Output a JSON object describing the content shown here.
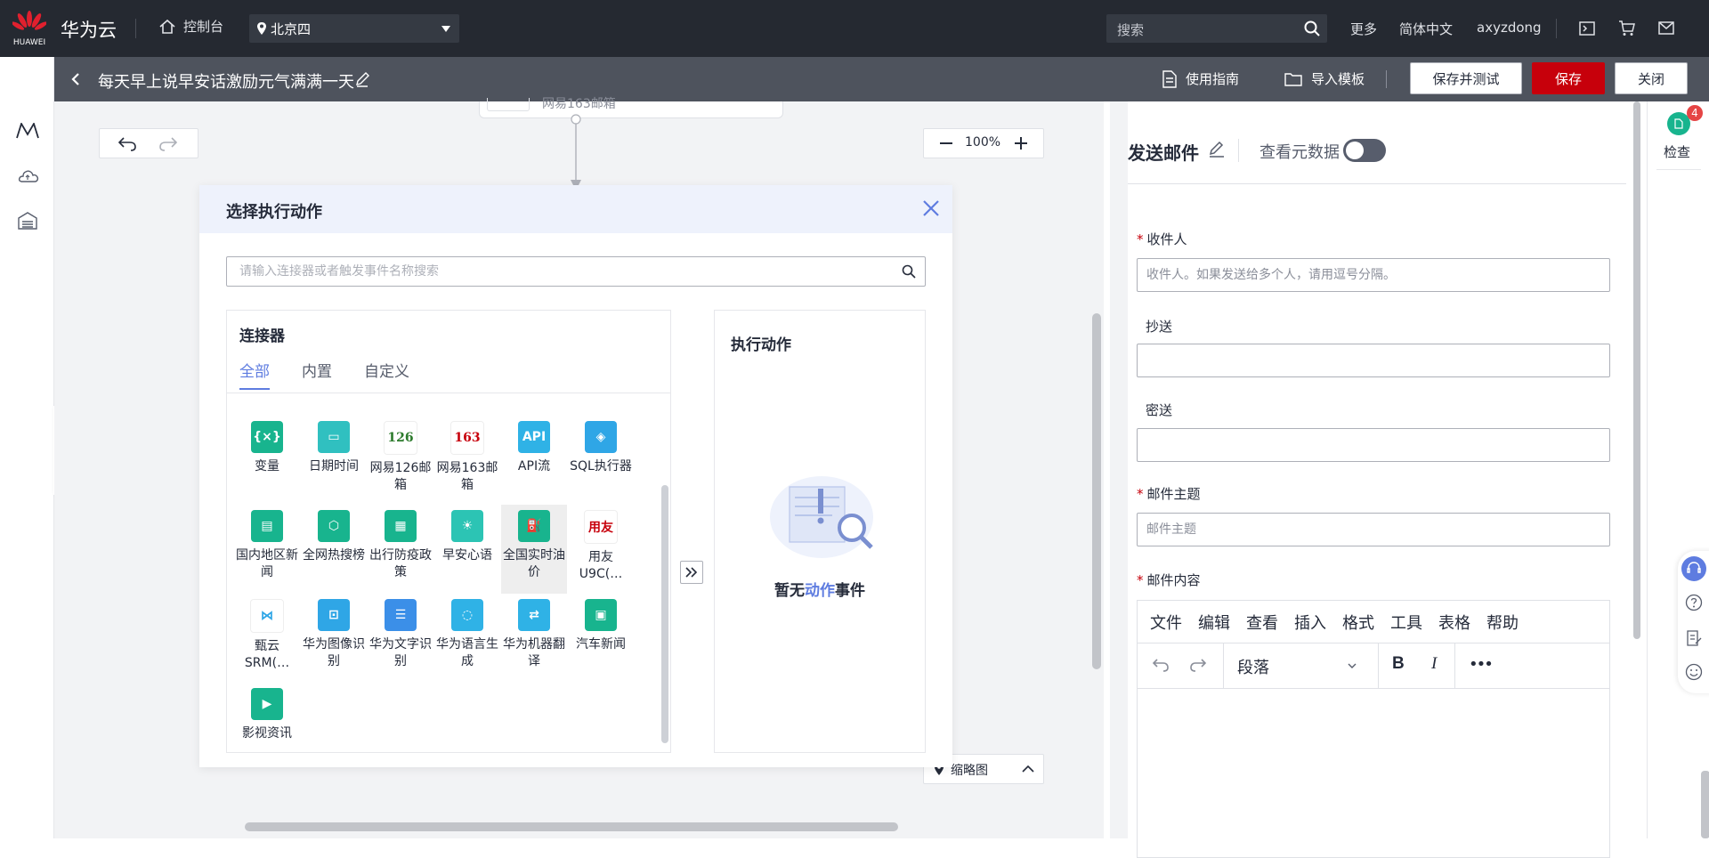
{
  "topbar": {
    "brand": "华为云",
    "logo_text": "HUAWEI",
    "console": "控制台",
    "region": "北京四",
    "search_placeholder": "搜索",
    "more": "更多",
    "language": "简体中文",
    "username": "axyzdong"
  },
  "subbar": {
    "title": "每天早上说早安话激励元气满满一天",
    "guide": "使用指南",
    "import": "导入模板",
    "save_test": "保存并测试",
    "save": "保存",
    "close": "关闭"
  },
  "canvas": {
    "top_node_label": "网易163邮箱",
    "zoom": "100%",
    "thumbnail": "缩略图"
  },
  "picker": {
    "title": "选择执行动作",
    "search_placeholder": "请输入连接器或者触发事件名称搜索",
    "connectors_title": "连接器",
    "tabs": [
      "全部",
      "内置",
      "自定义"
    ],
    "connectors": [
      {
        "label": "变量",
        "icon": "variable-icon",
        "glyph": "{×}",
        "color": "#18b48e"
      },
      {
        "label": "日期时间",
        "icon": "calendar-icon",
        "glyph": "▭",
        "color": "#30c0c0"
      },
      {
        "label": "网易126邮箱",
        "icon": "netease-126-icon",
        "glyph": "126",
        "color": "#ffffff",
        "text_color": "#2c7a2c"
      },
      {
        "label": "网易163邮箱",
        "icon": "netease-163-icon",
        "glyph": "163",
        "color": "#ffffff",
        "text_color": "#c7000b"
      },
      {
        "label": "API流",
        "icon": "api-icon",
        "glyph": "API",
        "color": "#2fb2e6"
      },
      {
        "label": "SQL执行器",
        "icon": "sql-icon",
        "glyph": "◈",
        "color": "#2fa6e6"
      },
      {
        "label": "国内地区新闻",
        "icon": "news-icon",
        "glyph": "▤",
        "color": "#18b48e"
      },
      {
        "label": "全网热搜榜",
        "icon": "hot-search-icon",
        "glyph": "⬡",
        "color": "#18b48e"
      },
      {
        "label": "出行防疫政策",
        "icon": "travel-policy-icon",
        "glyph": "▦",
        "color": "#18b48e"
      },
      {
        "label": "早安心语",
        "icon": "sunrise-icon",
        "glyph": "☀",
        "color": "#2cc4b4"
      },
      {
        "label": "全国实时油价",
        "icon": "oil-price-icon",
        "glyph": "⛽",
        "color": "#18b48e"
      },
      {
        "label": "用友U9C(…",
        "icon": "yonyou-icon",
        "glyph": "用友",
        "color": "#ffffff",
        "text_color": "#c7000b"
      },
      {
        "label": "甄云SRM(…",
        "icon": "zhenyun-icon",
        "glyph": "⋈",
        "color": "#ffffff",
        "text_color": "#2fa6e6"
      },
      {
        "label": "华为图像识别",
        "icon": "image-recognition-icon",
        "glyph": "⊡",
        "color": "#2fa6e6"
      },
      {
        "label": "华为文字识别",
        "icon": "text-recognition-icon",
        "glyph": "☰",
        "color": "#3b8fe8"
      },
      {
        "label": "华为语言生成",
        "icon": "language-generation-icon",
        "glyph": "◌",
        "color": "#2fb2e6"
      },
      {
        "label": "华为机器翻译",
        "icon": "machine-translation-icon",
        "glyph": "⇄",
        "color": "#2fb2e6"
      },
      {
        "label": "汽车新闻",
        "icon": "car-news-icon",
        "glyph": "▣",
        "color": "#18b48e"
      },
      {
        "label": "影视资讯",
        "icon": "film-icon",
        "glyph": "▶",
        "color": "#18b48e"
      }
    ],
    "actions_title": "执行动作",
    "empty_pre": "暂无",
    "empty_mid": "动作",
    "empty_post": "事件"
  },
  "props": {
    "title": "发送邮件",
    "metadata_toggle": "查看元数据",
    "recipient_label": "收件人",
    "recipient_placeholder": "收件人。如果发送给多个人，请用逗号分隔。",
    "cc_label": "抄送",
    "bcc_label": "密送",
    "subject_label": "邮件主题",
    "subject_placeholder": "邮件主题",
    "content_label": "邮件内容",
    "editor_menu": [
      "文件",
      "编辑",
      "查看",
      "插入",
      "格式",
      "工具",
      "表格",
      "帮助"
    ],
    "paragraph": "段落",
    "bold": "B",
    "italic": "I",
    "more": "•••"
  },
  "right_strip": {
    "check": "检查",
    "badge": "4"
  }
}
